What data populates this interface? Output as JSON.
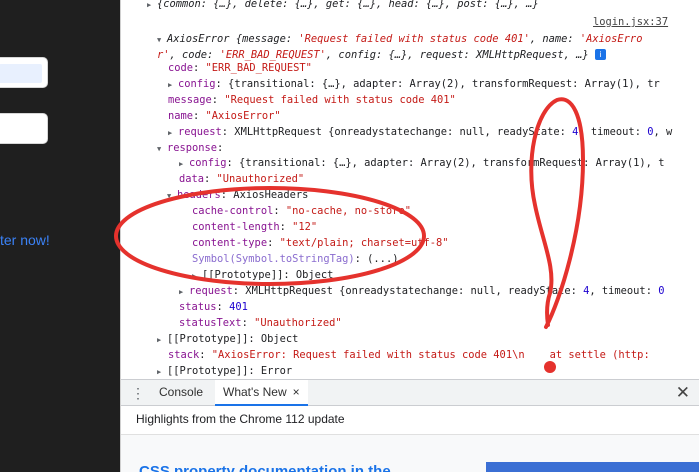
{
  "left_page": {
    "link_text": "ter now!"
  },
  "console": {
    "source_link": "login.jsx:37",
    "lines": [
      {
        "id": "top",
        "html": "<span class='tri'>▶</span><span class='obj italic'>{common: {…}, delete: {…}, get: {…}, head: {…}, post: {…}, …}</span>"
      },
      {
        "id": "err1",
        "html": "<span class='tri'>▼</span><span class='obj italic'>AxiosError {message: </span><span class='str italic'>'Request failed with status code 401'</span><span class='obj italic'>, name: </span><span class='str italic'>'AxiosErro</span>"
      },
      {
        "id": "err2",
        "html": "<span class='str italic'>r'</span><span class='obj italic'>, code: </span><span class='str italic'>'ERR_BAD_REQUEST'</span><span class='obj italic'>, config: {…}, request: XMLHttpRequest, …} </span><span id='info-icon'>i</span>"
      },
      {
        "id": "code",
        "html": "<span class='key'>code</span>: <span class='str'>\"ERR_BAD_REQUEST\"</span>"
      },
      {
        "id": "config",
        "html": "<span class='tri'>▶</span><span class='key'>config</span>: {transitional: {…}, adapter: Array(2), transformRequest: Array(1), tr"
      },
      {
        "id": "message",
        "html": "<span class='key'>message</span>: <span class='str'>\"Request failed with status code 401\"</span>"
      },
      {
        "id": "name",
        "html": "<span class='key'>name</span>: <span class='str'>\"AxiosError\"</span>"
      },
      {
        "id": "request",
        "html": "<span class='tri'>▶</span><span class='key'>request</span>: XMLHttpRequest {onreadystatechange: null, readyState: <span class='num'>4</span>, timeout: <span class='num'>0</span>, w"
      },
      {
        "id": "response",
        "html": "<span class='tri'>▼</span><span class='key'>response</span>:"
      },
      {
        "id": "r_config",
        "html": "<span class='tri'>▶</span><span class='key'>config</span>: {transitional: {…}, adapter: Array(2), transformRequest: Array(1), t"
      },
      {
        "id": "r_data",
        "html": "<span class='key'>data</span>: <span class='str'>\"Unauthorized\"</span>"
      },
      {
        "id": "r_headers",
        "html": "<span class='tri'>▼</span><span class='key'>headers</span>: AxiosHeaders"
      },
      {
        "id": "h_cache",
        "html": "<span class='key'>cache-control</span>: <span class='str'>\"no-cache, no-store\"</span>"
      },
      {
        "id": "h_len",
        "html": "<span class='key'>content-length</span>: <span class='str'>\"12\"</span>"
      },
      {
        "id": "h_type",
        "html": "<span class='key'>content-type</span>: <span class='str'>\"text/plain; charset=utf-8\"</span>"
      },
      {
        "id": "h_sym",
        "html": "<span class='sym'>Symbol(Symbol.toStringTag)</span>: <span class='obj'>(...)</span>"
      },
      {
        "id": "h_proto",
        "html": "<span class='tri'>▶</span><span class='obj'>[[Prototype]]</span>: Object"
      },
      {
        "id": "r_request",
        "html": "<span class='tri'>▶</span><span class='key'>request</span>: XMLHttpRequest {onreadystatechange: null, readyState: <span class='num'>4</span>, timeout: <span class='num'>0</span>"
      },
      {
        "id": "r_status",
        "html": "<span class='key'>status</span>: <span class='num'>401</span>"
      },
      {
        "id": "r_statustext",
        "html": "<span class='key'>statusText</span>: <span class='str'>\"Unauthorized\"</span>"
      },
      {
        "id": "r_proto",
        "html": "<span class='tri'>▶</span><span class='obj'>[[Prototype]]</span>: Object"
      },
      {
        "id": "stack",
        "html": "<span class='key'>stack</span>: <span class='str'>\"AxiosError: Request failed with status code 401\\n    at settle (http:</span>"
      },
      {
        "id": "proto",
        "html": "<span class='tri'>▶</span><span class='obj'>[[Prototype]]</span>: Error"
      }
    ]
  },
  "drawer": {
    "kebab_icon": "⋮",
    "tabs": [
      {
        "label": "Console",
        "active": false
      },
      {
        "label": "What's New",
        "active": true,
        "close": "×"
      }
    ],
    "close_icon": "✕",
    "highlights_text": "Highlights from the Chrome 112 update",
    "article_title": "CSS property documentation in the"
  },
  "colors": {
    "annotation": "#e5322d",
    "accent": "#1a73e8"
  }
}
